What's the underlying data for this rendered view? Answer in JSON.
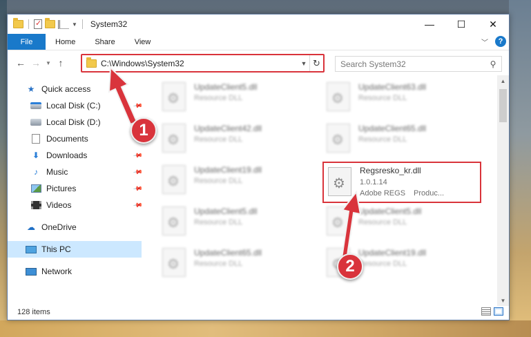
{
  "window": {
    "title": "System32",
    "controls": {
      "minimize": "—",
      "maximize": "☐",
      "close": "✕"
    }
  },
  "ribbon": {
    "tabs": [
      "File",
      "Home",
      "Share",
      "View"
    ]
  },
  "address": {
    "path": "C:\\Windows\\System32",
    "search_placeholder": "Search System32"
  },
  "navpane": {
    "quick_access": "Quick access",
    "quick_items": [
      {
        "label": "Local Disk (C:)",
        "icon": "drive-icon"
      },
      {
        "label": "Local Disk (D:)",
        "icon": "drive-icon"
      },
      {
        "label": "Documents",
        "icon": "documents-icon"
      },
      {
        "label": "Downloads",
        "icon": "downloads-icon"
      },
      {
        "label": "Music",
        "icon": "music-icon"
      },
      {
        "label": "Pictures",
        "icon": "pictures-icon"
      },
      {
        "label": "Videos",
        "icon": "videos-icon"
      }
    ],
    "onedrive": "OneDrive",
    "this_pc": "This PC",
    "network": "Network"
  },
  "files": [
    {
      "name": "UpdateClient5.dll",
      "desc": "Resource DLL"
    },
    {
      "name": "UpdateClient63.dll",
      "desc": "Resource DLL"
    },
    {
      "name": "UpdateClient42.dll",
      "desc": "Resource DLL"
    },
    {
      "name": "UpdateClient65.dll",
      "desc": "Resource DLL"
    },
    {
      "name": "UpdateClient19.dll",
      "desc": "Resource DLL"
    },
    {
      "name": "UpdateClient5.dll",
      "desc": "Resource DLL"
    },
    {
      "name": "UpdateClient5.dll",
      "desc": "Resource DLL"
    },
    {
      "name": "UpdateClient65.dll",
      "desc": "Resource DLL"
    },
    {
      "name": "UpdateClient19.dll",
      "desc": "Resource DLL"
    }
  ],
  "highlighted_file": {
    "name": "Regsresko_kr.dll",
    "version": "1.0.1.14",
    "company": "Adobe REGS",
    "product": "Produc..."
  },
  "status": {
    "item_count": "128 items"
  },
  "annotations": {
    "step1": "1",
    "step2": "2",
    "color": "#d9343c"
  }
}
